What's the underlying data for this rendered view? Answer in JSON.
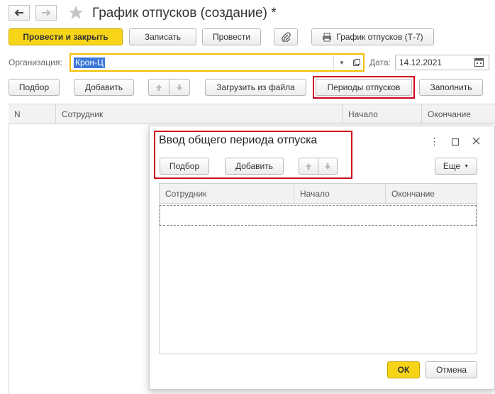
{
  "window": {
    "title": "График отпусков (создание) *"
  },
  "toolbar": {
    "post_close_label": "Провести и закрыть",
    "save_label": "Записать",
    "post_label": "Провести",
    "report_label": "График отпусков (Т-7)"
  },
  "form": {
    "organization_label": "Организация:",
    "organization_value": "Крон-Ц",
    "date_label": "Дата:",
    "date_value": "14.12.2021"
  },
  "table_toolbar": {
    "select_label": "Подбор",
    "add_label": "Добавить",
    "load_label": "Загрузить из файла",
    "periods_label": "Периоды отпусков",
    "fill_label": "Заполнить"
  },
  "table": {
    "columns": [
      "N",
      "Сотрудник",
      "Начало",
      "Окончание"
    ]
  },
  "dialog": {
    "title": "Ввод общего периода отпуска",
    "select_label": "Подбор",
    "add_label": "Добавить",
    "more_label": "Еще",
    "columns": [
      "Сотрудник",
      "Начало",
      "Окончание"
    ],
    "ok_label": "ОК",
    "cancel_label": "Отмена"
  },
  "colors": {
    "primary_button": "#f7d417",
    "highlight": "#d0021b",
    "field_focus": "#f0c000",
    "selection": "#3c78d8"
  }
}
